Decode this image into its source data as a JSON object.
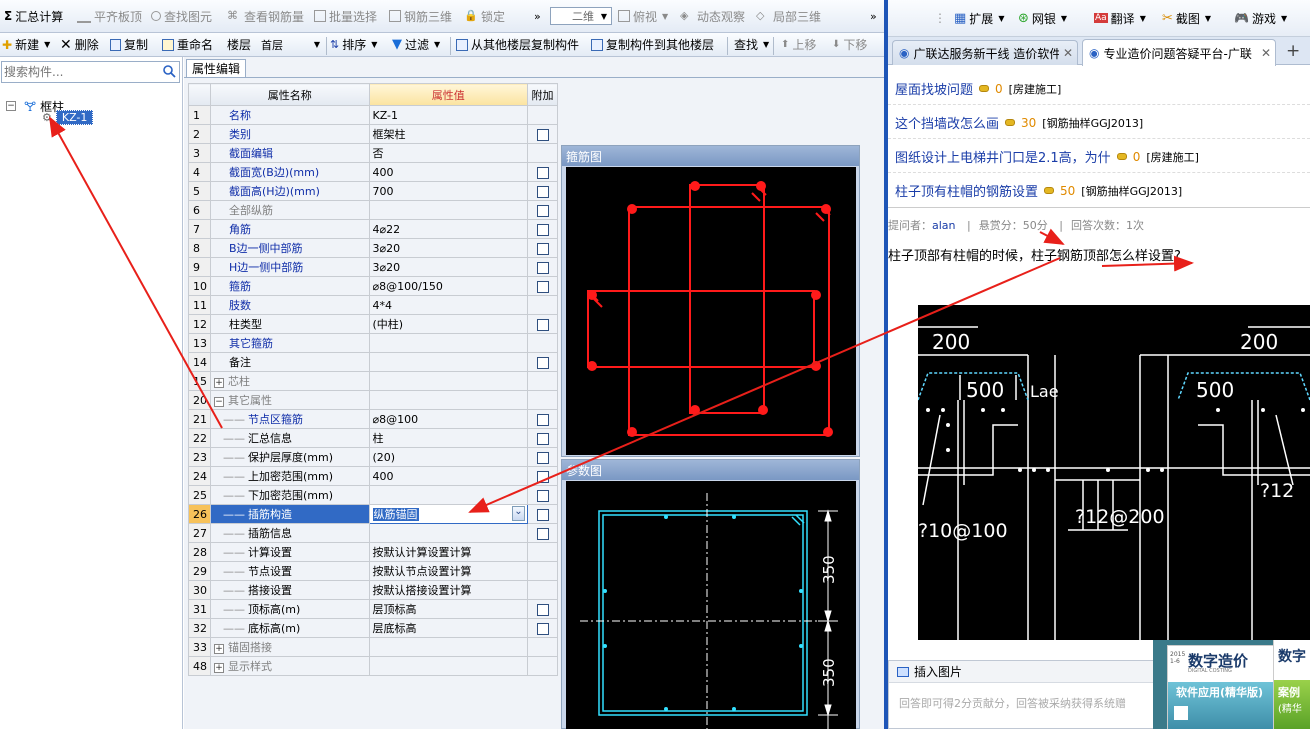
{
  "toolbar1": {
    "sum": "汇总计算",
    "flat_top": "平齐板顶",
    "find_elem": "查找图元",
    "view_rebar": "查看钢筋量",
    "batch_select": "批量选择",
    "rebar_3d": "钢筋三维",
    "lock": "锁定",
    "view_mode": "二维",
    "top_view": "俯视",
    "dynamic_view": "动态观察",
    "local_3d": "局部三维"
  },
  "toolbar2": {
    "new": "新建",
    "delete": "删除",
    "copy": "复制",
    "rename": "重命名",
    "floor_label": "楼层",
    "floor_value": "首层",
    "sort": "排序",
    "filter": "过滤",
    "copy_from": "从其他楼层复制构件",
    "copy_to": "复制构件到其他楼层",
    "find": "查找",
    "move_up": "上移",
    "move_down": "下移"
  },
  "search": {
    "placeholder": "搜索构件..."
  },
  "tree": {
    "root": "框柱",
    "child": "KZ-1"
  },
  "panel_tab": "属性编辑",
  "grid": {
    "headers": {
      "name": "属性名称",
      "value": "属性值",
      "extra": "附加"
    },
    "rows": [
      {
        "num": "1",
        "name": "名称",
        "value": "KZ-1"
      },
      {
        "num": "2",
        "name": "类别",
        "value": "框架柱"
      },
      {
        "num": "3",
        "name": "截面编辑",
        "value": "否"
      },
      {
        "num": "4",
        "name": "截面宽(B边)(mm)",
        "value": "400"
      },
      {
        "num": "5",
        "name": "截面高(H边)(mm)",
        "value": "700"
      },
      {
        "num": "6",
        "name": "全部纵筋",
        "value": ""
      },
      {
        "num": "7",
        "name": "角筋",
        "value": "4⌀22"
      },
      {
        "num": "8",
        "name": "B边一侧中部筋",
        "value": "3⌀20"
      },
      {
        "num": "9",
        "name": "H边一侧中部筋",
        "value": "3⌀20"
      },
      {
        "num": "10",
        "name": "箍筋",
        "value": "⌀8@100/150"
      },
      {
        "num": "11",
        "name": "肢数",
        "value": "4*4"
      },
      {
        "num": "12",
        "name": "柱类型",
        "value": "(中柱)"
      },
      {
        "num": "13",
        "name": "其它箍筋",
        "value": ""
      },
      {
        "num": "14",
        "name": "备注",
        "value": ""
      },
      {
        "num": "15",
        "name": "芯柱",
        "value": ""
      },
      {
        "num": "20",
        "name": "其它属性",
        "value": ""
      },
      {
        "num": "21",
        "name": "节点区箍筋",
        "value": "⌀8@100"
      },
      {
        "num": "22",
        "name": "汇总信息",
        "value": "柱"
      },
      {
        "num": "23",
        "name": "保护层厚度(mm)",
        "value": "(20)"
      },
      {
        "num": "24",
        "name": "上加密范围(mm)",
        "value": "400"
      },
      {
        "num": "25",
        "name": "下加密范围(mm)",
        "value": ""
      },
      {
        "num": "26",
        "name": "插筋构造",
        "value": "纵筋锚固"
      },
      {
        "num": "27",
        "name": "插筋信息",
        "value": ""
      },
      {
        "num": "28",
        "name": "计算设置",
        "value": "按默认计算设置计算"
      },
      {
        "num": "29",
        "name": "节点设置",
        "value": "按默认节点设置计算"
      },
      {
        "num": "30",
        "name": "搭接设置",
        "value": "按默认搭接设置计算"
      },
      {
        "num": "31",
        "name": "顶标高(m)",
        "value": "层顶标高"
      },
      {
        "num": "32",
        "name": "底标高(m)",
        "value": "层底标高"
      },
      {
        "num": "33",
        "name": "锚固搭接",
        "value": ""
      },
      {
        "num": "48",
        "name": "显示样式",
        "value": ""
      }
    ]
  },
  "stirrup_panel": {
    "title": "箍筋图"
  },
  "param_panel": {
    "title": "参数图",
    "dim_top": "350",
    "dim_bottom": "350"
  },
  "browser": {
    "toolbar": {
      "extend": "扩展",
      "bank": "网银",
      "translate": "翻译",
      "screenshot": "截图",
      "games": "游戏"
    },
    "tabs": [
      "广联达服务新干线 造价软件",
      "专业造价问题答疑平台-广联"
    ],
    "questions": [
      {
        "title": "屋面找坡问题",
        "points": "0",
        "category": "[房建施工]"
      },
      {
        "title": "这个挡墙改怎么画",
        "points": "30",
        "category": "[钢筋抽样GGJ2013]"
      },
      {
        "title": "图纸设计上电梯井门口是2.1高，为什",
        "points": "0",
        "category": "[房建施工]"
      },
      {
        "title": "柱子顶有柱帽的钢筋设置",
        "points": "50",
        "category": "[钢筋抽样GGJ2013]"
      }
    ],
    "meta": {
      "asker_label": "提问者：",
      "asker": "alan",
      "reward": "悬赏分：50分",
      "answers": "回答次数：1次"
    },
    "question_text": "柱子顶部有柱帽的时候，柱子钢筋顶部怎么样设置?",
    "drawing": {
      "dim1": "200",
      "dim2": "500",
      "lae": "Lae",
      "dim3": "200",
      "dim4": "500",
      "stirrup1": "?10@100",
      "stirrup2": "?12@200",
      "stirrup3": "?12"
    },
    "insert_image": "插入图片",
    "answer_placeholder": "回答即可得2分贡献分，回答被采纳获得系统赠",
    "ad_title": "数字造价",
    "ad_sub": "软件应用(精华版)",
    "ad_title2": "数字",
    "ad_sub2": "案例",
    "ad_sub3": "(精华",
    "ad_en": "DIGITAL COSTING",
    "ad_issue": "2015\n1-6"
  },
  "colors": {
    "accent": "#1a3da8",
    "selection": "#316ac5",
    "rebar_red": "#ff1a1a",
    "param_cyan": "#33e0ff"
  }
}
